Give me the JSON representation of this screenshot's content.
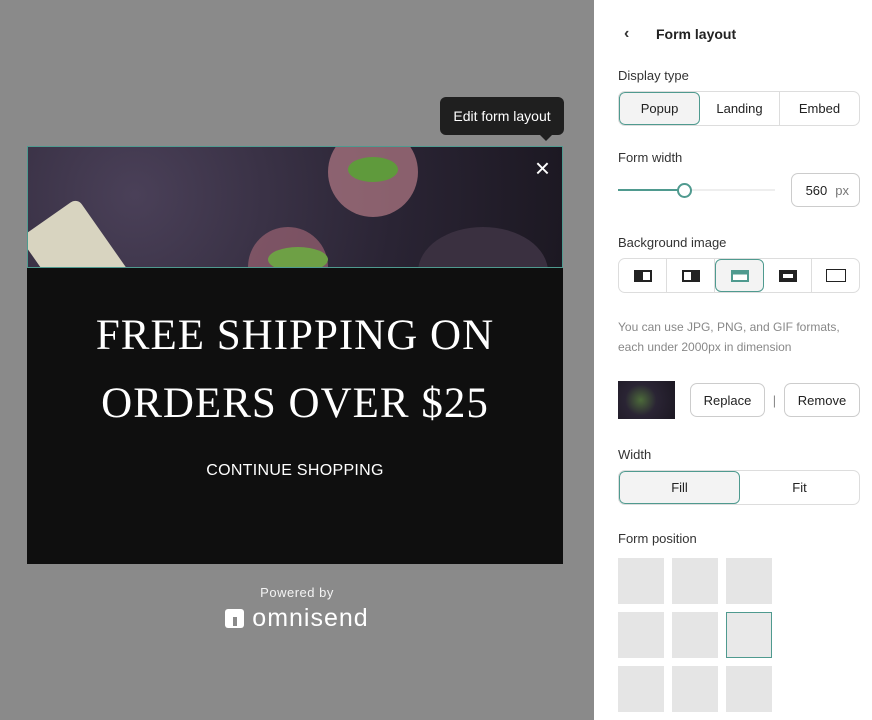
{
  "canvas": {
    "tooltip": "Edit form layout",
    "headline_line1": "FREE SHIPPING ON",
    "headline_line2": "ORDERS OVER $25",
    "cta": "CONTINUE SHOPPING",
    "close_icon": "×",
    "powered_by": "Powered by",
    "brand": "omnisend"
  },
  "panel": {
    "back_icon": "‹",
    "title": "Form layout",
    "display_type": {
      "label": "Display type",
      "options": [
        "Popup",
        "Landing",
        "Embed"
      ],
      "selected": "Popup"
    },
    "form_width": {
      "label": "Form width",
      "value": "560",
      "unit": "px",
      "slider_fraction": 0.42
    },
    "background_image": {
      "label": "Background image",
      "options": [
        "image-left-icon",
        "image-right-icon",
        "image-top-icon",
        "image-inset-icon",
        "image-full-icon"
      ],
      "selected": 2,
      "hint": "You can use JPG, PNG, and GIF formats, each under 2000px in dimension",
      "replace": "Replace",
      "separator": "|",
      "remove": "Remove"
    },
    "width": {
      "label": "Width",
      "options": [
        "Fill",
        "Fit"
      ],
      "selected": "Fill"
    },
    "form_position": {
      "label": "Form position",
      "selected_index": 5
    },
    "accent": "#4f9a8f"
  }
}
